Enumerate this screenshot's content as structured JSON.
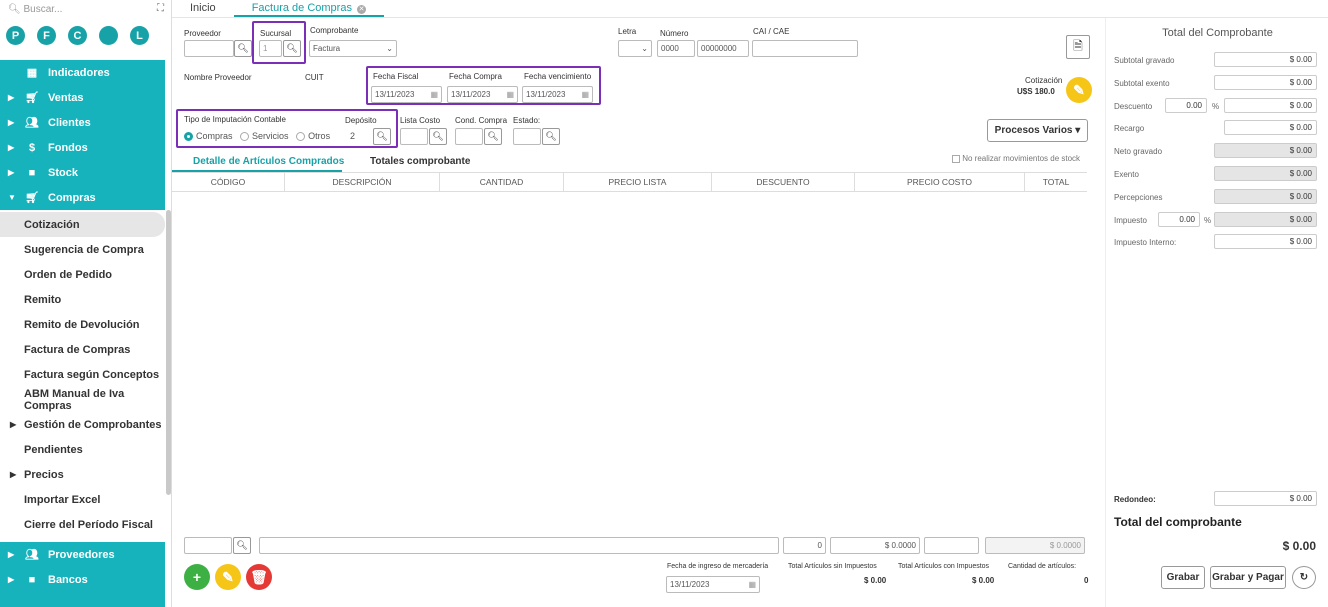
{
  "sidebar": {
    "search_placeholder": "Buscar...",
    "circles": [
      "P",
      "F",
      "C",
      "",
      "L"
    ],
    "top_items": [
      {
        "label": "Indicadores",
        "icon": "dashboard-icon"
      },
      {
        "label": "Ventas",
        "icon": "cart-icon"
      },
      {
        "label": "Clientes",
        "icon": "users-icon"
      },
      {
        "label": "Fondos",
        "icon": "dollar-icon"
      },
      {
        "label": "Stock",
        "icon": "box-icon"
      },
      {
        "label": "Compras",
        "icon": "cart-icon"
      }
    ],
    "sub_items": [
      "Cotización",
      "Sugerencia de Compra",
      "Orden de Pedido",
      "Remito",
      "Remito de Devolución",
      "Factura de Compras",
      "Factura según Conceptos",
      "ABM Manual de Iva Compras",
      "Gestión de Comprobantes",
      "Pendientes",
      "Precios",
      "Importar Excel",
      "Cierre del Período Fiscal"
    ],
    "bottom_items": [
      "Proveedores",
      "Bancos"
    ]
  },
  "tabs": [
    "Inicio",
    "Factura de Compras"
  ],
  "form": {
    "proveedor": "Proveedor",
    "sucursal": "Sucursal",
    "sucursal_val": "1",
    "comprobante": "Comprobante",
    "comprobante_val": "Factura",
    "letra": "Letra",
    "numero": "Número",
    "numero_a": "0000",
    "numero_b": "00000000",
    "cai": "CAI / CAE",
    "nombre_proveedor": "Nombre Proveedor",
    "cuit": "CUIT",
    "fecha_fiscal": "Fecha Fiscal",
    "fecha_compra": "Fecha Compra",
    "fecha_venc": "Fecha vencimiento",
    "date": "13/11/2023",
    "cotizacion": "Cotización",
    "cotizacion_val": "U$S 180.0",
    "tipo_imp": "Tipo de Imputación Contable",
    "compras": "Compras",
    "servicios": "Servicios",
    "otros": "Otros",
    "deposito": "Depósito",
    "deposito_val": "2",
    "lista_costo": "Lista Costo",
    "cond_compra": "Cond. Compra",
    "estado": "Estado:",
    "procesos": "Procesos Varios",
    "no_stock": "No realizar movimientos de stock"
  },
  "subtabs": [
    "Detalle de Artículos Comprados",
    "Totales comprobante"
  ],
  "grid": {
    "headers": [
      "CÓDIGO",
      "DESCRIPCIÓN",
      "CANTIDAD",
      "PRECIO LISTA",
      "DESCUENTO",
      "PRECIO COSTO",
      "TOTAL"
    ]
  },
  "footer": {
    "qty": "0",
    "price": "$ 0.0000",
    "total": "$ 0.0000",
    "fecha_ingreso": "Fecha de ingreso de mercadería",
    "fecha_val": "13/11/2023",
    "sin_imp": "Total Artículos sin Impuestos",
    "con_imp": "Total Artículos con Impuestos",
    "cantidad": "Cantidad de artículos:",
    "sin_val": "$ 0.00",
    "con_val": "$ 0.00",
    "cant_val": "0"
  },
  "totals": {
    "title": "Total del Comprobante",
    "subtotal_gravado": "Subtotal gravado",
    "subtotal_exento": "Subtotal exento",
    "descuento": "Descuento",
    "descuento_pct": "0.00",
    "recargo": "Recargo",
    "neto": "Neto gravado",
    "exento": "Exento",
    "percepciones": "Percepciones",
    "impuesto": "Impuesto",
    "impuesto_pct": "0.00",
    "imp_interno": "Impuesto Interno:",
    "zero": "$ 0.00",
    "pct": "%",
    "redondeo": "Redondeo:",
    "total_label": "Total del comprobante",
    "total_val": "$ 0.00",
    "grabar": "Grabar",
    "grabar_pagar": "Grabar y Pagar"
  }
}
